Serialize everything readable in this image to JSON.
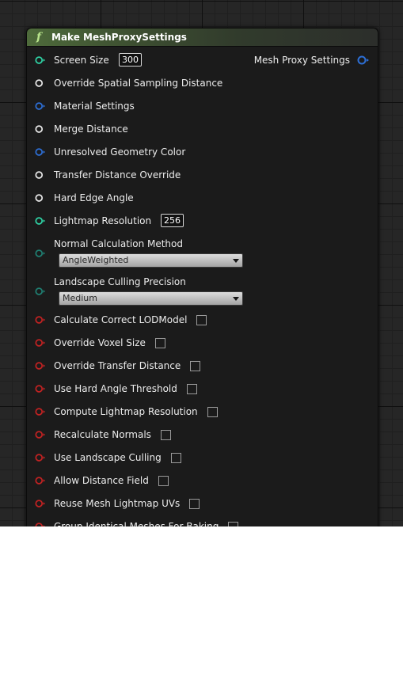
{
  "node": {
    "title": "Make MeshProxySettings",
    "title_icon": "function-icon",
    "output_label": "Mesh Proxy Settings",
    "colors": {
      "teal": "#2fd3a5",
      "white": "#e8e8e8",
      "blue": "#2d6fd6",
      "red": "#c22222",
      "dark_teal": "#1f7f72"
    },
    "inputs": [
      {
        "label": "Screen Size",
        "pin_color": "teal",
        "value": "300"
      },
      {
        "label": "Override Spatial Sampling Distance",
        "pin_color": "white"
      },
      {
        "label": "Material Settings",
        "pin_color": "blue"
      },
      {
        "label": "Merge Distance",
        "pin_color": "white"
      },
      {
        "label": "Unresolved Geometry Color",
        "pin_color": "blue"
      },
      {
        "label": "Transfer Distance Override",
        "pin_color": "white"
      },
      {
        "label": "Hard Edge Angle",
        "pin_color": "white"
      },
      {
        "label": "Lightmap Resolution",
        "pin_color": "teal",
        "value": "256"
      },
      {
        "label": "Normal Calculation Method",
        "pin_color": "dark_teal",
        "selected": "AngleWeighted"
      },
      {
        "label": "Landscape Culling Precision",
        "pin_color": "dark_teal",
        "selected": "Medium"
      },
      {
        "label": "Calculate Correct LODModel",
        "pin_color": "red",
        "checked": false
      },
      {
        "label": "Override Voxel Size",
        "pin_color": "red",
        "checked": false
      },
      {
        "label": "Override Transfer Distance",
        "pin_color": "red",
        "checked": false
      },
      {
        "label": "Use Hard Angle Threshold",
        "pin_color": "red",
        "checked": false
      },
      {
        "label": "Compute Lightmap Resolution",
        "pin_color": "red",
        "checked": false
      },
      {
        "label": "Recalculate Normals",
        "pin_color": "red",
        "checked": false
      },
      {
        "label": "Use Landscape Culling",
        "pin_color": "red",
        "checked": false
      },
      {
        "label": "Allow Distance Field",
        "pin_color": "red",
        "checked": false
      },
      {
        "label": "Reuse Mesh Lightmap UVs",
        "pin_color": "red",
        "checked": false
      },
      {
        "label": "Group Identical Meshes For Baking",
        "pin_color": "red",
        "checked": false
      }
    ]
  }
}
